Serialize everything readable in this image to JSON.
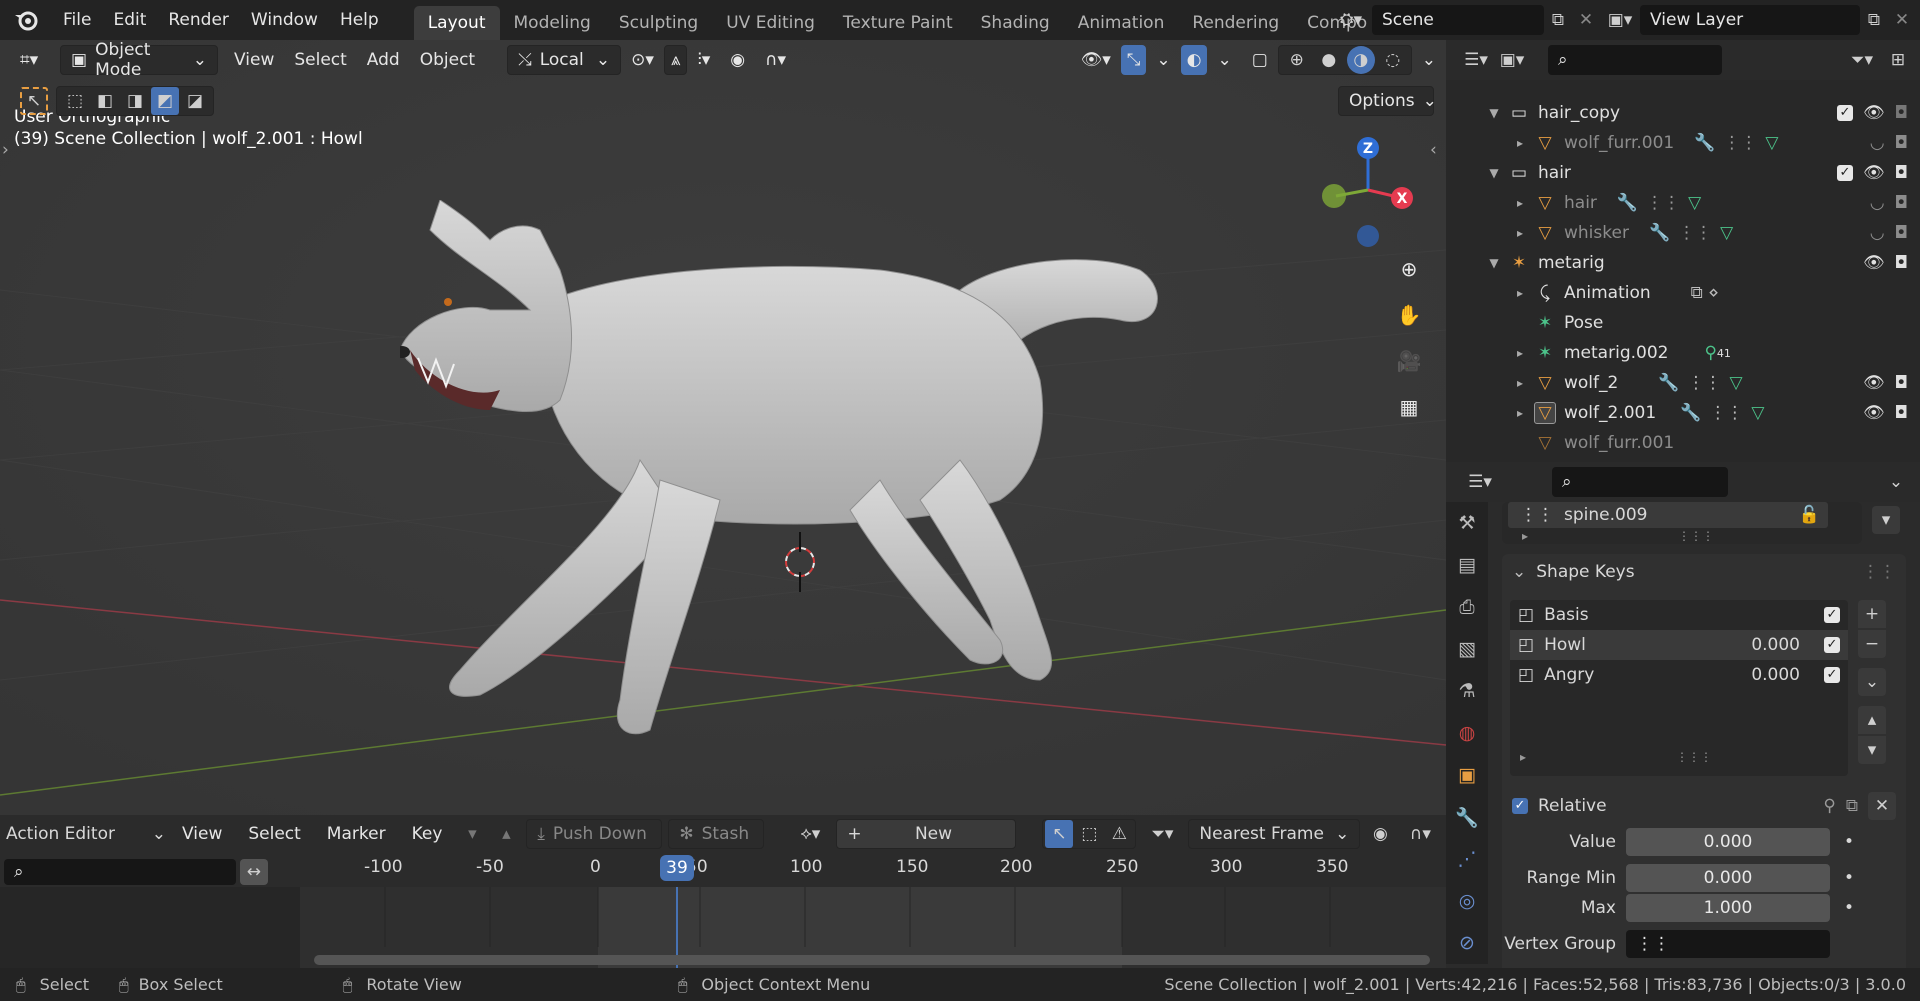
{
  "menu": {
    "items": [
      "File",
      "Edit",
      "Render",
      "Window",
      "Help"
    ]
  },
  "workspaces": {
    "tabs": [
      "Layout",
      "Modeling",
      "Sculpting",
      "UV Editing",
      "Texture Paint",
      "Shading",
      "Animation",
      "Rendering",
      "Compo"
    ],
    "active": "Layout"
  },
  "scene": {
    "name": "Scene",
    "view_layer": "View Layer"
  },
  "viewport": {
    "mode": "Object Mode",
    "menus": [
      "View",
      "Select",
      "Add",
      "Object"
    ],
    "transform_orientation": "Local",
    "options_label": "Options",
    "overlay_line1": "User Orthographic",
    "overlay_line2": "(39) Scene Collection | wolf_2.001 : Howl",
    "gizmo": {
      "z": "Z",
      "x": "X"
    }
  },
  "outliner": {
    "rows": [
      {
        "label": "hair_copy",
        "dim": false,
        "checked": true
      },
      {
        "label": "wolf_furr.001",
        "dim": true
      },
      {
        "label": "hair",
        "dim": false,
        "checked": true
      },
      {
        "label": "hair",
        "dim": true
      },
      {
        "label": "whisker",
        "dim": true
      },
      {
        "label": "metarig",
        "dim": false
      },
      {
        "label": "Animation",
        "dim": false
      },
      {
        "label": "Pose",
        "dim": false
      },
      {
        "label": "metarig.002",
        "dim": false,
        "badge": "41"
      },
      {
        "label": "wolf_2",
        "dim": false
      },
      {
        "label": "wolf_2.001",
        "dim": false
      },
      {
        "label": "wolf_furr.001",
        "dim": true
      }
    ]
  },
  "properties": {
    "vertex_group_item": "spine.009",
    "shape_keys_title": "Shape Keys",
    "shape_keys": [
      {
        "name": "Basis",
        "value": ""
      },
      {
        "name": "Howl",
        "value": "0.000"
      },
      {
        "name": "Angry",
        "value": "0.000"
      }
    ],
    "relative_label": "Relative",
    "value_label": "Value",
    "value": "0.000",
    "range_min_label": "Range Min",
    "range_min": "0.000",
    "max_label": "Max",
    "max": "1.000",
    "vertex_group_label": "Vertex Group"
  },
  "action_editor": {
    "mode": "Action Editor",
    "menus": [
      "View",
      "Select",
      "Marker",
      "Key"
    ],
    "push_down": "Push Down",
    "stash": "Stash",
    "new_label": "New",
    "snap": "Nearest Frame",
    "ruler": [
      "-100",
      "-50",
      "0",
      "50",
      "100",
      "150",
      "200",
      "250",
      "300",
      "350"
    ],
    "current_frame": "39"
  },
  "status": {
    "select": "Select",
    "box_select": "Box Select",
    "rotate": "Rotate View",
    "context_menu": "Object Context Menu",
    "stats": "Scene Collection | wolf_2.001 | Verts:42,216 | Faces:52,568 | Tris:83,736 | Objects:0/3 | 3.0.0"
  },
  "colors": {
    "accent": "#4772b3",
    "x_axis": "#e53b50",
    "y_axis": "#7ea837",
    "z_axis": "#2f6ed6",
    "object_orange": "#e89e42"
  }
}
